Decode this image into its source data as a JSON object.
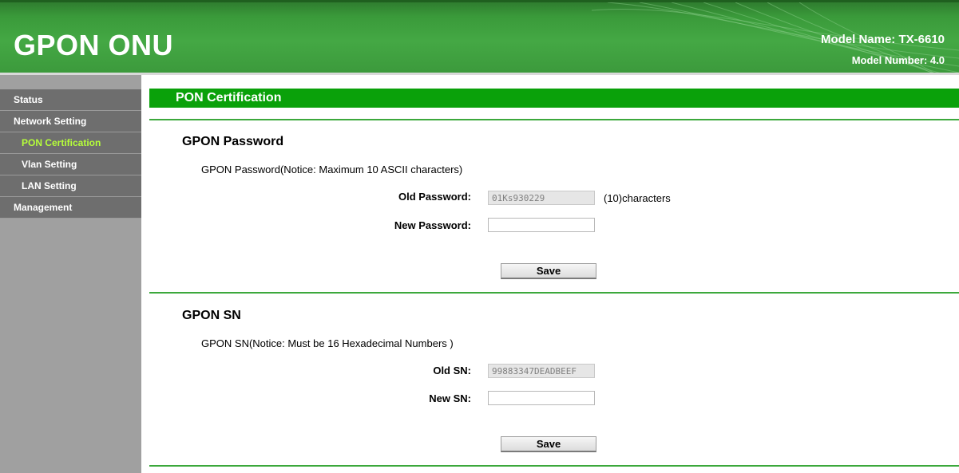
{
  "header": {
    "logo": "GPON ONU",
    "model_name": "Model Name: TX-6610",
    "model_number": "Model Number: 4.0"
  },
  "sidebar": {
    "items": [
      {
        "label": "Status",
        "level": 1,
        "active": false
      },
      {
        "label": "Network Setting",
        "level": 1,
        "active": false
      },
      {
        "label": "PON Certification",
        "level": 2,
        "active": true
      },
      {
        "label": "Vlan Setting",
        "level": 2,
        "active": false
      },
      {
        "label": "LAN Setting",
        "level": 2,
        "active": false
      },
      {
        "label": "Management",
        "level": 1,
        "active": false
      }
    ]
  },
  "page": {
    "title": "PON Certification",
    "password_section": {
      "title": "GPON Password",
      "notice": "GPON Password(Notice: Maximum 10 ASCII characters)",
      "old_label": "Old Password:",
      "old_value": "01Ks930229",
      "old_suffix": "(10)characters",
      "new_label": "New Password:",
      "new_value": "",
      "save_label": "Save"
    },
    "sn_section": {
      "title": "GPON SN",
      "notice": "GPON SN(Notice: Must be 16 Hexadecimal Numbers )",
      "old_label": "Old SN:",
      "old_value": "99883347DEADBEEF",
      "new_label": "New SN:",
      "new_value": "",
      "save_label": "Save"
    }
  },
  "colors": {
    "header_green": "#44a844",
    "title_bar_green": "#0aa10a",
    "divider_green": "#3ca83c",
    "sidebar_item_bg": "#6e6e6e",
    "sidebar_bg": "#a0a0a0",
    "active_nav_text": "#b6ff3a"
  }
}
